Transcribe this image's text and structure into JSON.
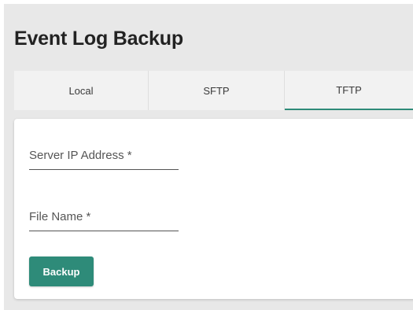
{
  "page": {
    "title": "Event Log Backup"
  },
  "tabs": [
    {
      "label": "Local",
      "active": false
    },
    {
      "label": "SFTP",
      "active": false
    },
    {
      "label": "TFTP",
      "active": true
    }
  ],
  "form": {
    "server_ip": {
      "label": "Server IP Address *",
      "value": ""
    },
    "file_name": {
      "label": "File Name *",
      "value": ""
    },
    "backup_label": "Backup"
  },
  "colors": {
    "accent": "#2e8b79",
    "background": "#e8e8e8",
    "card": "#ffffff"
  }
}
